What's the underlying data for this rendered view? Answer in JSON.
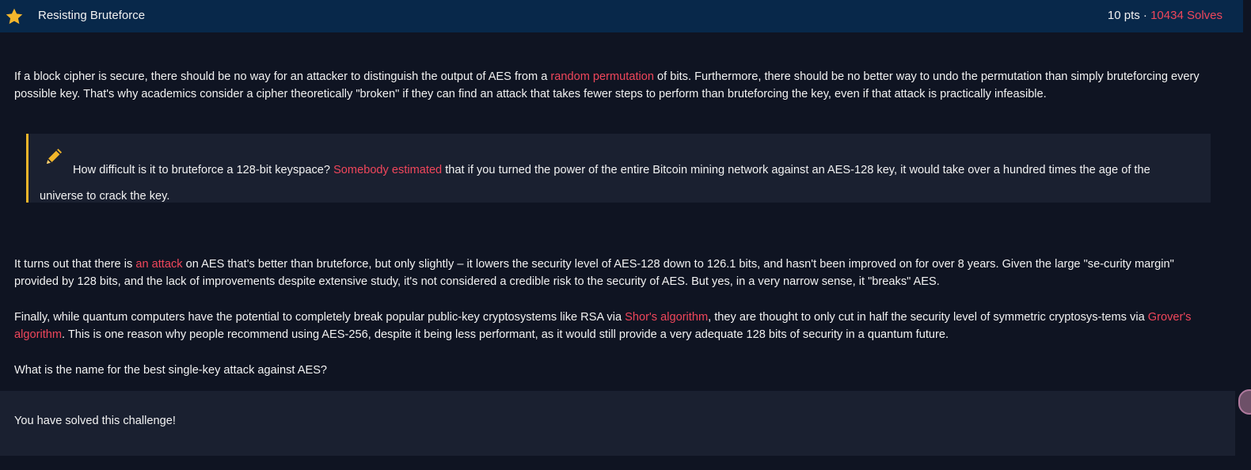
{
  "header": {
    "title": "Resisting Bruteforce",
    "points": "10 pts · ",
    "solves": "10434 Solves",
    "icon": "star-icon"
  },
  "paragraph1": {
    "before": "If a block cipher is secure, there should be no way for an attacker to distinguish the output of AES from a ",
    "link": "random permutation",
    "after": " of bits. Furthermore, there should be no better way to undo the permutation than simply bruteforcing every possible key. That's why academics consider a cipher theoretically \"broken\" if they can find an attack that takes fewer steps to perform than bruteforcing the key, even if that attack is practically infeasible."
  },
  "callout": {
    "icon": "pencil-icon",
    "before": "How difficult is it to bruteforce a 128-bit keyspace? ",
    "link": "Somebody estimated",
    "after": " that if you turned the power of the entire Bitcoin mining network against an AES-128 key, it would take over a hundred times the age of the universe to crack the key."
  },
  "paragraph2": {
    "before": "It turns out that there is ",
    "link": "an attack",
    "after": " on AES that's better than bruteforce, but only slightly – it lowers the security level of AES-128 down to 126.1 bits, and hasn't been improved on for over 8 years. Given the large \"se-curity margin\" provided by 128 bits, and the lack of improvements despite extensive study, it's not considered a credible risk to the security of AES. But yes, in a very narrow sense, it \"breaks\" AES."
  },
  "paragraph3": {
    "before": "Finally, while quantum computers have the potential to completely break popular public-key cryptosystems like RSA via ",
    "link1": "Shor's algorithm",
    "middle": ", they are thought to only cut in half the security level of symmetric cryptosys-tems via ",
    "link2": "Grover's algorithm",
    "after": ". This is one reason why people recommend using AES-256, despite it being less performant, as it would still provide a very adequate 128 bits of security in a quantum future."
  },
  "question": "What is the name for the best single-key attack against AES?",
  "solved": "You have solved this challenge!",
  "colors": {
    "accent": "#f0465b",
    "header_bg": "#08284a",
    "callout_border": "#f1b52a"
  }
}
